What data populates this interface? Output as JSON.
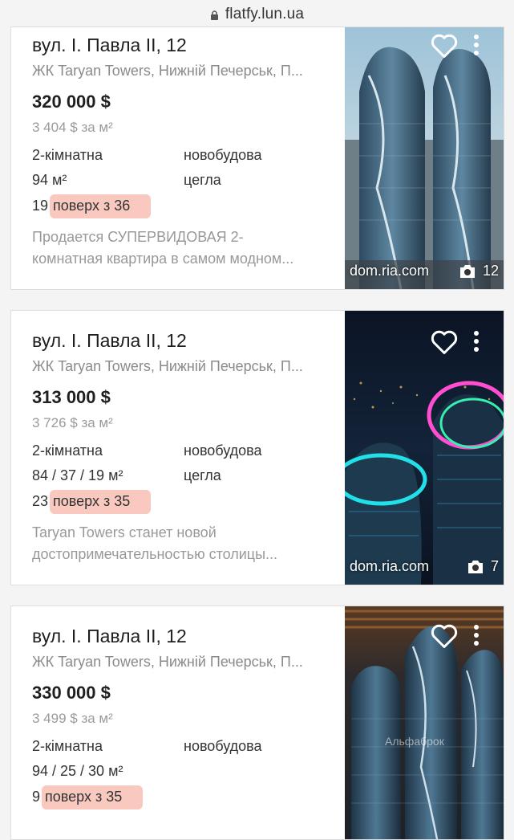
{
  "browser": {
    "url": "flatfy.lun.ua"
  },
  "listings": [
    {
      "address": "вул. І. Павла II, 12",
      "complex": "ЖК Taryan Towers, Нижній Печерськ, П...",
      "price": "320 000 $",
      "price_per_sqm": "3 404 $ за м²",
      "rooms": "2-кімнатна",
      "building_type": "новобудова",
      "area": "94 м²",
      "wall": "цегла",
      "floor_num": "19",
      "floor_of": "поверх з 36",
      "desc_line1": "Продается СУПЕРВИДОВАЯ 2-",
      "desc_line2": "комнатная квартира в самом модном...",
      "source": "dom.ria.com",
      "photo_count": "12"
    },
    {
      "address": "вул. І. Павла II, 12",
      "complex": "ЖК Taryan Towers, Нижній Печерськ, П...",
      "price": "313 000 $",
      "price_per_sqm": "3 726 $ за м²",
      "rooms": "2-кімнатна",
      "building_type": "новобудова",
      "area": "84 / 37 / 19 м²",
      "wall": "цегла",
      "floor_num": "23",
      "floor_of": "поверх з 35",
      "desc_line1": "Taryan Towers станет новой",
      "desc_line2": "достопримечательностью столицы...",
      "source": "dom.ria.com",
      "photo_count": "7"
    },
    {
      "address": "вул. І. Павла II, 12",
      "complex": "ЖК Taryan Towers, Нижній Печерськ, П...",
      "price": "330 000 $",
      "price_per_sqm": "3 499 $ за м²",
      "rooms": "2-кімнатна",
      "building_type": "новобудова",
      "area": "94 / 25 / 30 м²",
      "floor_num": "9",
      "floor_of": "поверх з 35",
      "watermark": "Альфаброк"
    }
  ],
  "colors": {
    "floor_highlight": "#f9c9c0",
    "card_border": "#dddddd"
  },
  "icons": [
    "lock-icon",
    "heart-icon",
    "more-vertical-icon",
    "camera-icon"
  ]
}
